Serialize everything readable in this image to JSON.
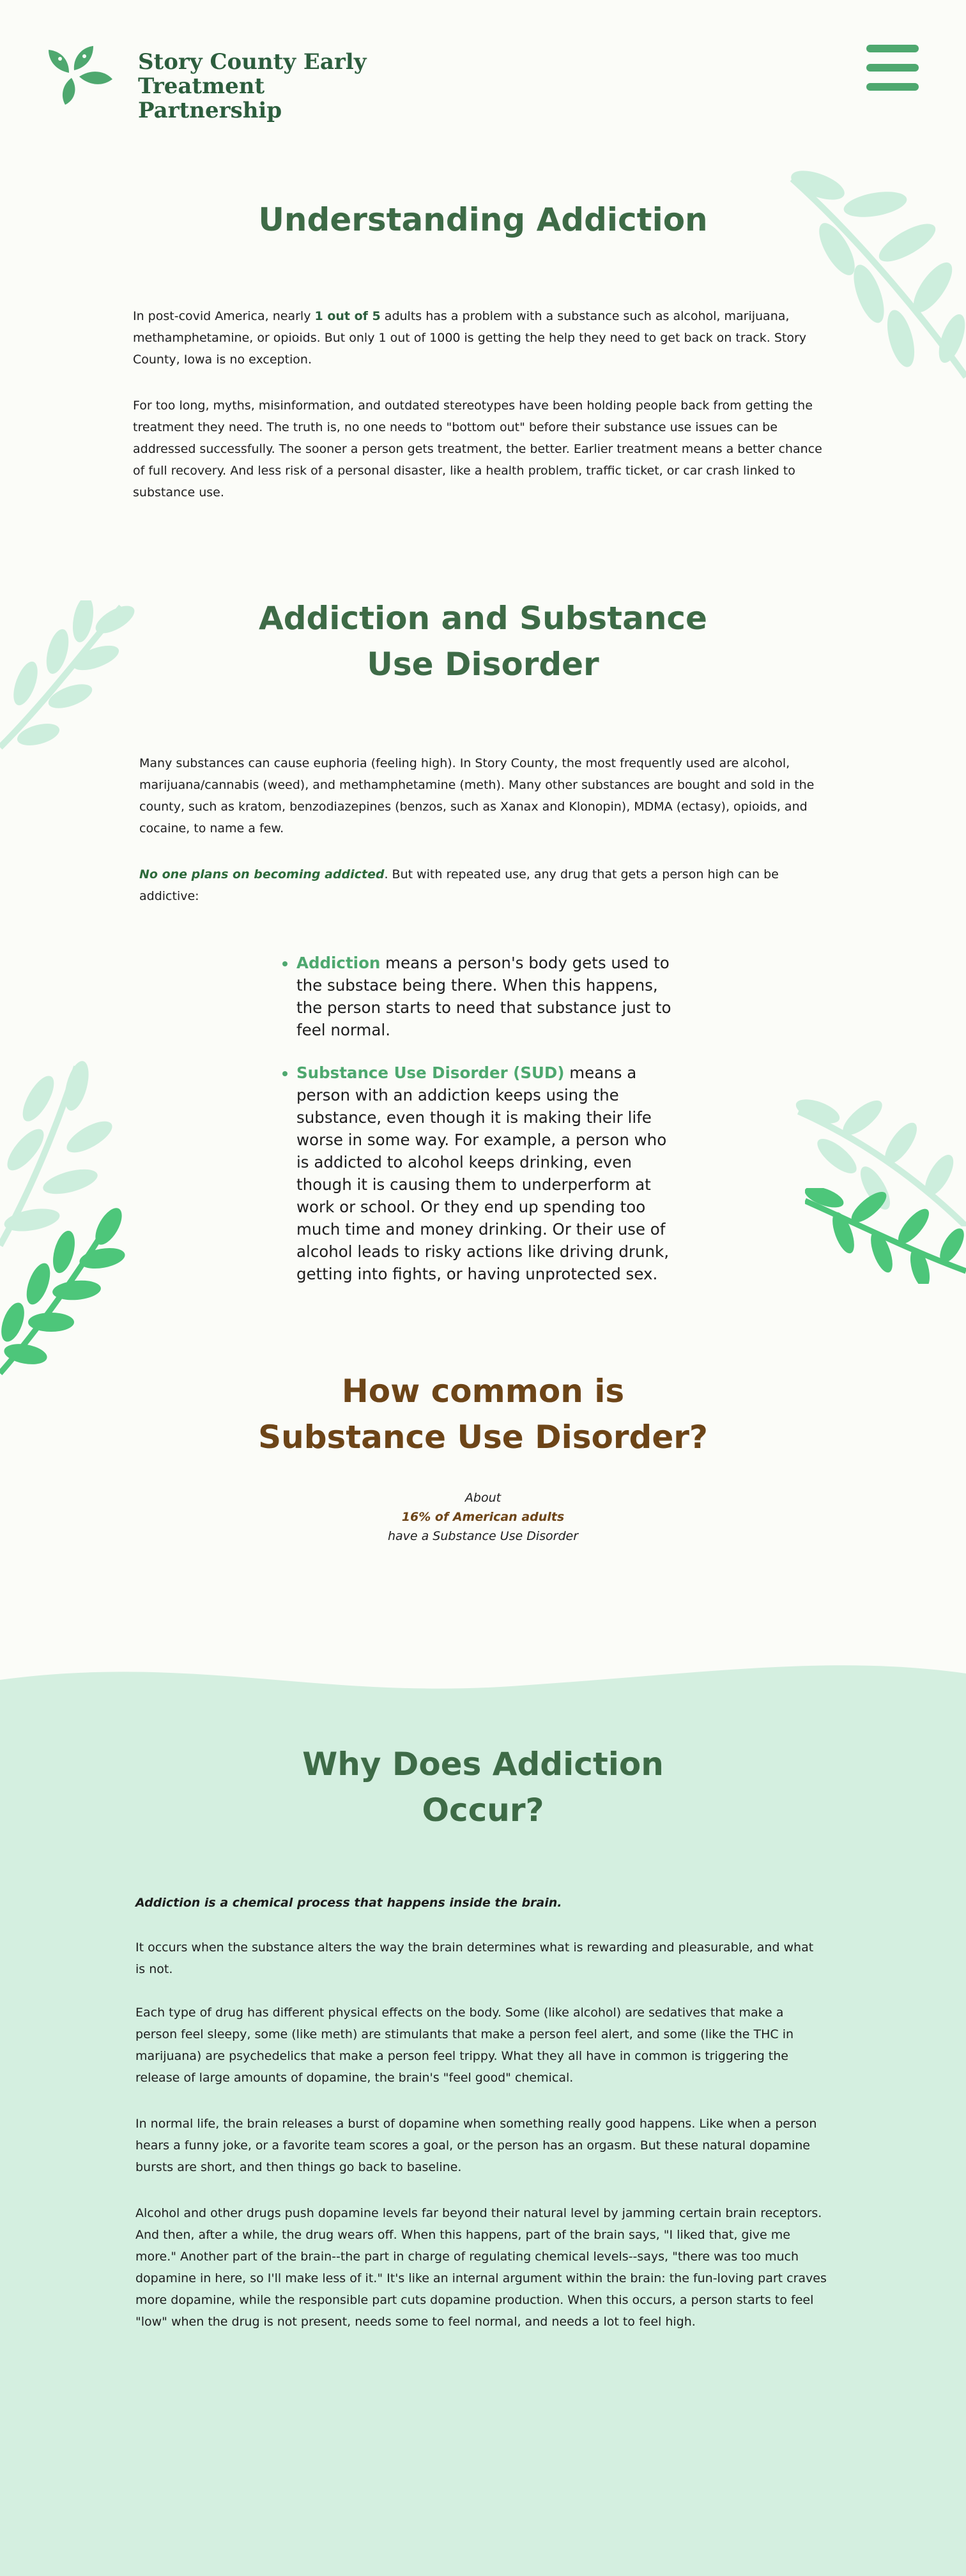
{
  "header": {
    "logo_line1": "Story County Early",
    "logo_line2": "Treatment Partnership"
  },
  "icons": {
    "logo": "leaf-cluster-icon",
    "menu": "hamburger-menu-icon",
    "decoration": "fern-leaf-icon"
  },
  "colors": {
    "background": "#fbfcf8",
    "brand_green": "#4ea86f",
    "heading_green": "#3e6b47",
    "heading_brown": "#6d4518",
    "mint": "#d4efe0",
    "leaf_light": "#cdeedd",
    "leaf_bright": "#4dc67a"
  },
  "understanding": {
    "title": "Understanding Addiction",
    "p1_before": "In post-covid America, nearly ",
    "p1_highlight": "1 out of 5",
    "p1_after": " adults has a problem with a substance such as alcohol, marijuana, methamphetamine, or opioids. But only 1 out of 1000 is getting the help they need to get back on track. Story County, Iowa is no exception.",
    "p2": "For too long, myths, misinformation, and outdated stereotypes have been holding people back from getting the treatment they need. The truth is, no one needs to \"bottom out\" before their substance use issues can be addressed successfully. The sooner a person gets treatment, the better. Earlier treatment means a better chance of full recovery. And less risk of a personal disaster, like a health problem, traffic ticket, or car crash linked to substance use."
  },
  "sud": {
    "title_line1": "Addiction and Substance",
    "title_line2": "Use Disorder",
    "p1": "Many substances can cause euphoria (feeling high). In Story County, the most frequently used are alcohol, marijuana/cannabis (weed), and methamphetamine (meth). Many other substances are bought and sold in the county, such as kratom, benzodiazepines (benzos, such as Xanax and Klonopin), MDMA (ectasy), opioids, and cocaine, to name a few.",
    "p2_emphasis": "No one plans on becoming addicted",
    "p2_rest": ". But with repeated use, any drug that gets a person high can be addictive:",
    "items": [
      {
        "term": "Addiction",
        "text": " means a person's body gets used to the substace being there. When this happens, the person starts to need that substance just to feel normal."
      },
      {
        "term": "Substance Use Disorder (SUD)",
        "text": " means a person with an addiction keeps using the substance, even though it is making their life worse in some way. For example, a person who is addicted to alcohol keeps drinking, even though it is causing them to underperform at work or school. Or they end up spending too much time and money drinking. Or their use of alcohol leads to risky actions like driving drunk, getting into fights, or having unprotected sex."
      }
    ]
  },
  "common": {
    "title_line1": "How common is",
    "title_line2": "Substance Use Disorder?",
    "about": "About",
    "stat": "16% of American adults",
    "stat_rest": "have a Substance Use Disorder"
  },
  "why": {
    "title_line1": "Why Does Addiction",
    "title_line2": "Occur?",
    "lead": "Addiction is a chemical process that happens inside the brain.",
    "p1": "It occurs when the substance alters the way the brain determines what is rewarding and pleasurable, and what is not.",
    "p2": "Each type of drug has different physical effects on the body. Some (like alcohol) are sedatives that make a person feel sleepy, some (like meth) are stimulants that make a person feel alert, and some (like the THC in marijuana) are psychedelics that make a person feel trippy. What they all have in common is triggering the release of large amounts of dopamine, the brain's \"feel good\" chemical.",
    "p3": "In normal life, the brain releases a burst of dopamine when something really good happens. Like when a person hears a funny joke, or a favorite team scores a goal, or the person has an orgasm. But these natural dopamine bursts are short, and then things go back to baseline.",
    "p4": "Alcohol and other drugs push dopamine levels far beyond their natural level by jamming certain brain receptors. And then, after a while, the drug wears off.  When this happens, part of the brain says, \"I liked that, give me more.\" Another part of the brain--the part in charge of regulating chemical levels--says, \"there was too much dopamine in here, so I'll make less of it.\" It's like an internal argument within the brain: the fun-loving part craves more dopamine, while the responsible part cuts dopamine production. When this occurs, a person starts to feel \"low\" when the drug is not present, needs some to feel normal, and needs a lot to feel high."
  }
}
